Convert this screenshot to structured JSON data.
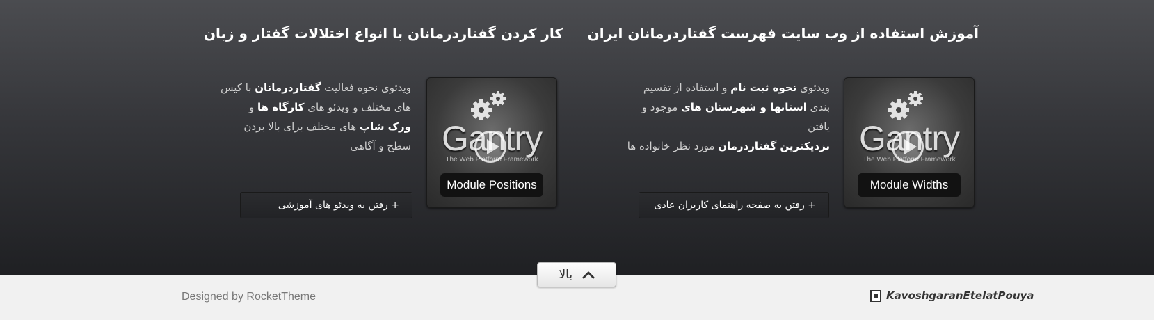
{
  "columns": [
    {
      "title": "آموزش استفاده از وب سایت فهرست گفتاردرمانان ایران",
      "thumb": {
        "logo": "Gantry",
        "tagline": "The Web Platform Framework",
        "badge": "Module Widths",
        "icon": "play-icon"
      },
      "desc": {
        "l1a": "ویدئوی ",
        "l1b": "نحوه ثبت نام",
        "l1c": " و استفاده از تقسیم",
        "l2a": "بندی ",
        "l2b": "استانها و شهرستان های",
        "l2c": " موجود و یافتن",
        "l3a": "نزدیکترین گفتاردرمان",
        "l3b": " مورد نظر خانواده ها"
      },
      "button": "+ رفتن به صفحه راهنمای کاربران عادی"
    },
    {
      "title": "کار کردن گفتاردرمانان با انواع اختلالات گفتار و زبان",
      "thumb": {
        "logo": "Gantry",
        "tagline": "The Web Platform Framework",
        "badge": "Module Positions",
        "icon": "play-icon"
      },
      "desc": {
        "l1a": "ویدئوی نحوه فعالیت ",
        "l1b": "گفتاردرمانان",
        "l1c": " با کیس",
        "l2a": "های مختلف و ویدئو های ",
        "l2b": "کارگاه ها",
        "l2c": " و",
        "l3a": "ورک شاپ",
        "l3b": " های مختلف برای بالا بردن",
        "l4": "سطح و آگاهی"
      },
      "button": "+ رفتن به ویدئو های آموزشی"
    }
  ],
  "top_button": {
    "label": "بالا",
    "icon": "chevron-up-icon"
  },
  "footer": {
    "designed_by": "Designed by RocketTheme",
    "brand": "KavoshgaranEtelatPouya"
  }
}
